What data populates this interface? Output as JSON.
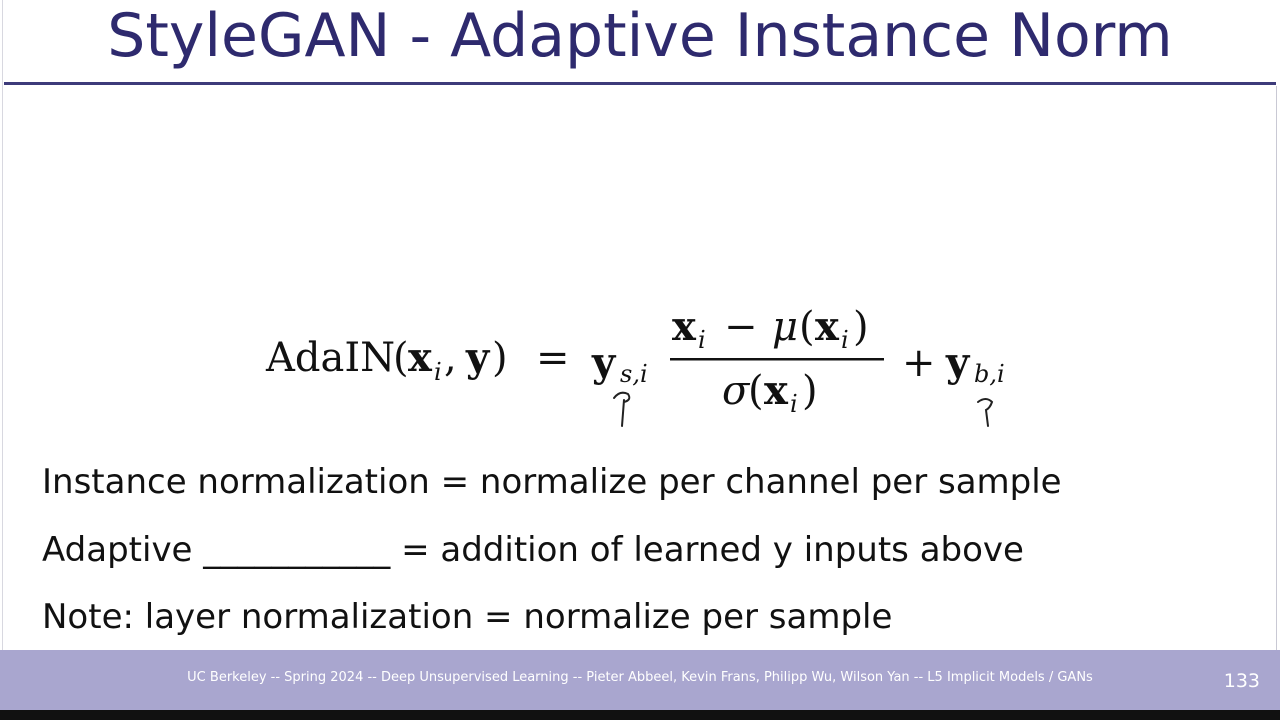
{
  "slide": {
    "title": "StyleGAN - Adaptive Instance Norm",
    "formula": {
      "lhs_name": "AdaIN",
      "lhs_args": [
        "x",
        "i",
        "y"
      ],
      "scale_term": "y",
      "scale_sub": "s,i",
      "numerator": [
        "x",
        "i",
        "μ",
        "x",
        "i"
      ],
      "denominator": [
        "σ",
        "x",
        "i"
      ],
      "bias_term": "y",
      "bias_sub": "b,i"
    },
    "bullets": [
      "Instance normalization = normalize per channel per sample",
      "Adaptive ___________ = addition of learned y inputs above",
      "Note: layer normalization = normalize per sample"
    ]
  },
  "footer": {
    "text": "UC Berkeley -- Spring 2024 -- Deep Unsupervised Learning -- Pieter Abbeel, Kevin Frans, Philipp Wu, Wilson Yan  -- L5 Implicit Models / GANs",
    "slide_number": "133"
  }
}
